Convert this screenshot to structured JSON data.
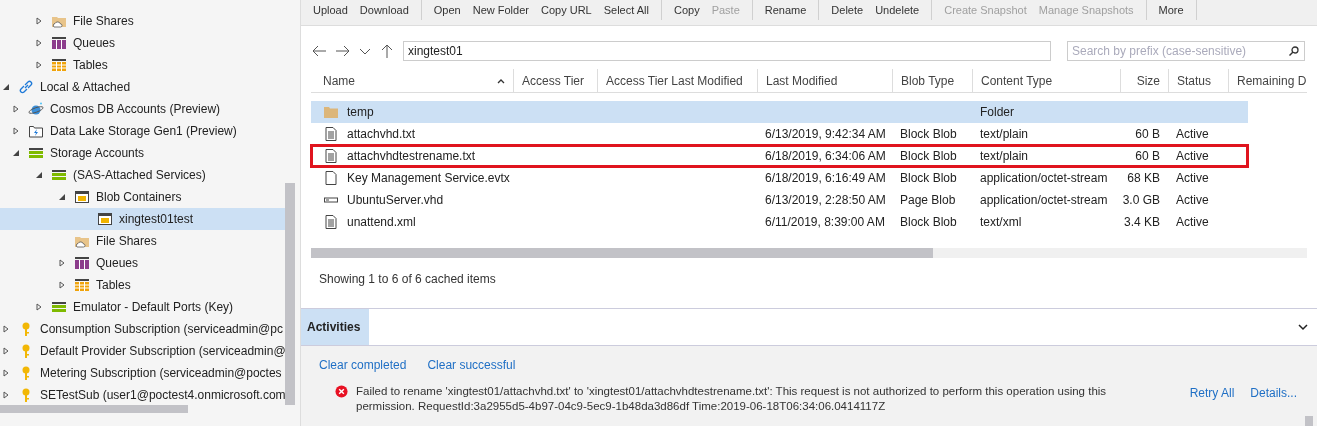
{
  "tree": [
    {
      "children": [
        {
          "children": [
            {
              "label": "File Shares",
              "kind": "fileshare",
              "expanded": false,
              "selected": false
            },
            {
              "label": "Queues",
              "kind": "queue",
              "expanded": false,
              "selected": false
            },
            {
              "label": "Tables",
              "kind": "table",
              "expanded": false,
              "selected": false
            }
          ]
        }
      ]
    },
    {
      "label": "Local & Attached",
      "kind": "link",
      "expanded": true,
      "selected": false,
      "children": [
        {
          "label": "Cosmos DB Accounts (Preview)",
          "kind": "cosmos",
          "expanded": false,
          "selected": false
        },
        {
          "label": "Data Lake Storage Gen1 (Preview)",
          "kind": "datalake",
          "expanded": false,
          "selected": false
        },
        {
          "label": "Storage Accounts",
          "kind": "storage",
          "expanded": true,
          "selected": false,
          "children": [
            {
              "label": "(SAS-Attached Services)",
              "kind": "storage",
              "expanded": true,
              "selected": false,
              "children": [
                {
                  "label": "Blob Containers",
                  "kind": "blob",
                  "expanded": true,
                  "selected": false,
                  "children": [
                    {
                      "label": "xingtest01test",
                      "kind": "blob",
                      "selected": true
                    }
                  ]
                },
                {
                  "label": "File Shares",
                  "kind": "fileshare",
                  "selected": false
                },
                {
                  "label": "Queues",
                  "kind": "queue",
                  "expanded": false,
                  "selected": false
                },
                {
                  "label": "Tables",
                  "kind": "table",
                  "expanded": false,
                  "selected": false
                }
              ]
            },
            {
              "label": "Emulator - Default Ports (Key)",
              "kind": "storage",
              "expanded": false,
              "selected": false
            }
          ]
        }
      ]
    },
    {
      "label": "Consumption Subscription (serviceadmin@pc",
      "kind": "key",
      "expanded": false,
      "selected": false
    },
    {
      "label": "Default Provider Subscription (serviceadmin@",
      "kind": "key",
      "expanded": false,
      "selected": false
    },
    {
      "label": "Metering Subscription (serviceadmin@poctes",
      "kind": "key",
      "expanded": false,
      "selected": false
    },
    {
      "label": "SETestSub (user1@poctest4.onmicrosoft.com",
      "kind": "key",
      "expanded": false,
      "selected": false
    }
  ],
  "toolbar": [
    [
      {
        "label": "Upload",
        "disabled": false
      },
      {
        "label": "Download",
        "disabled": false
      }
    ],
    [
      {
        "label": "Open",
        "disabled": false
      },
      {
        "label": "New Folder",
        "disabled": false
      },
      {
        "label": "Copy URL",
        "disabled": false
      },
      {
        "label": "Select All",
        "disabled": false
      }
    ],
    [
      {
        "label": "Copy",
        "disabled": false
      },
      {
        "label": "Paste",
        "disabled": true
      }
    ],
    [
      {
        "label": "Rename",
        "disabled": false
      }
    ],
    [
      {
        "label": "Delete",
        "disabled": false
      },
      {
        "label": "Undelete",
        "disabled": false
      }
    ],
    [
      {
        "label": "Create Snapshot",
        "disabled": true
      },
      {
        "label": "Manage Snapshots",
        "disabled": true
      }
    ],
    [
      {
        "label": "More",
        "disabled": false
      }
    ]
  ],
  "path": "xingtest01",
  "search": {
    "placeholder": "Search by prefix (case-sensitive)"
  },
  "table": {
    "columns": [
      "Name",
      "Access Tier",
      "Access Tier Last Modified",
      "Last Modified",
      "Blob Type",
      "Content Type",
      "Size",
      "Status",
      "Remaining D"
    ],
    "rows": [
      {
        "kind": "folder",
        "name": "temp",
        "last_modified": "",
        "blob_type": "",
        "content_type": "Folder",
        "size": "",
        "status": "",
        "selected": true,
        "highlighted": false
      },
      {
        "kind": "text",
        "name": "attachvhd.txt",
        "last_modified": "6/13/2019, 9:42:34 AM",
        "blob_type": "Block Blob",
        "content_type": "text/plain",
        "size": "60 B",
        "status": "Active",
        "selected": false,
        "highlighted": false
      },
      {
        "kind": "text",
        "name": "attachvhdtestrename.txt",
        "last_modified": "6/18/2019, 6:34:06 AM",
        "blob_type": "Block Blob",
        "content_type": "text/plain",
        "size": "60 B",
        "status": "Active",
        "selected": false,
        "highlighted": true
      },
      {
        "kind": "file",
        "name": "Key Management Service.evtx",
        "last_modified": "6/18/2019, 6:16:49 AM",
        "blob_type": "Block Blob",
        "content_type": "application/octet-stream",
        "size": "68 KB",
        "status": "Active",
        "selected": false,
        "highlighted": false
      },
      {
        "kind": "disk",
        "name": "UbuntuServer.vhd",
        "last_modified": "6/13/2019, 2:28:50 AM",
        "blob_type": "Page Blob",
        "content_type": "application/octet-stream",
        "size": "3.0 GB",
        "status": "Active",
        "selected": false,
        "highlighted": false
      },
      {
        "kind": "text",
        "name": "unattend.xml",
        "last_modified": "6/11/2019, 8:39:00 AM",
        "blob_type": "Block Blob",
        "content_type": "text/xml",
        "size": "3.4 KB",
        "status": "Active",
        "selected": false,
        "highlighted": false
      }
    ]
  },
  "status": "Showing 1 to 6 of 6 cached items",
  "activities": {
    "tabs": [
      {
        "label": "Activities",
        "selected": true
      }
    ],
    "links": [
      "Clear completed",
      "Clear successful"
    ],
    "items": [
      {
        "kind": "error",
        "message": "Failed to rename 'xingtest01/attachvhd.txt' to 'xingtest01/attachvhdtestrename.txt': This request is not authorized to perform this operation using this permission. RequestId:3a2955d5-4b97-04c9-5ec9-1b48da3d86df Time:2019-06-18T06:34:06.0414117Z",
        "actions": [
          "Retry All",
          "Details..."
        ]
      }
    ]
  }
}
